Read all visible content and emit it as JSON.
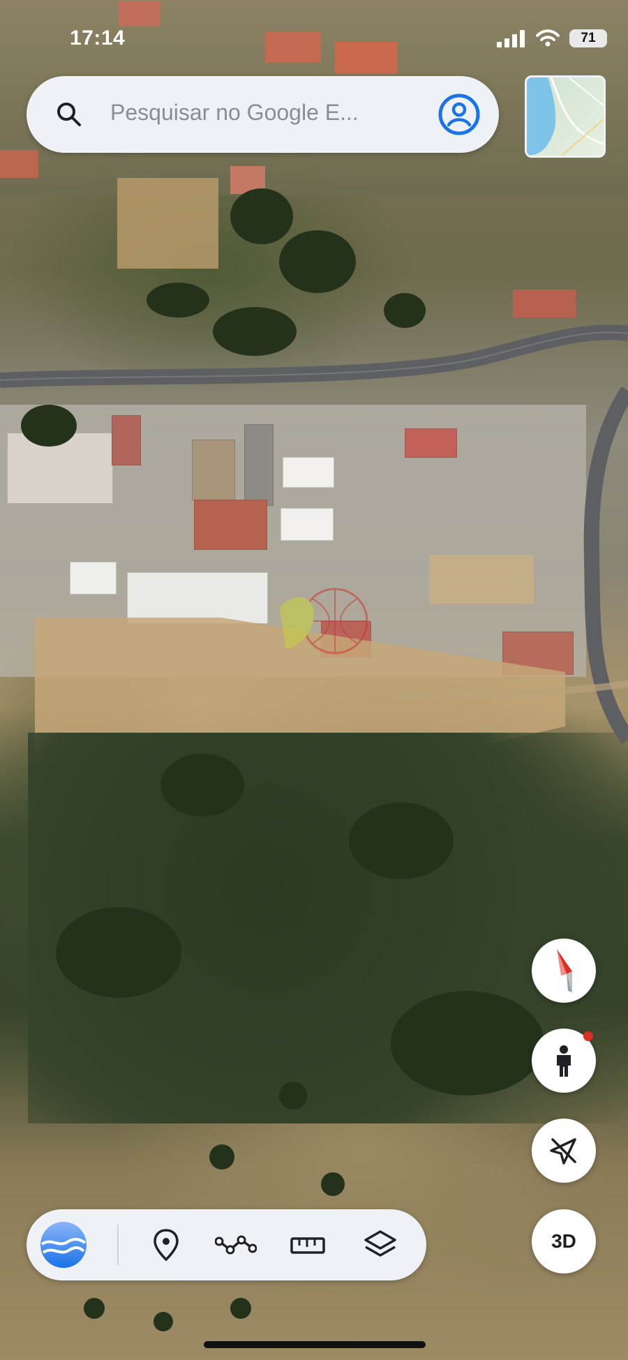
{
  "status_bar": {
    "time": "17:14",
    "battery": "71",
    "icons": [
      "cellular-signal-icon",
      "wifi-icon",
      "battery-icon"
    ]
  },
  "search": {
    "placeholder": "Pesquisar no Google E...",
    "left_icon": "search-icon",
    "right_icon": "account-icon"
  },
  "map": {
    "type": "satellite",
    "thumbnail": "map-layer-thumbnail"
  },
  "controls": {
    "compass": "compass-icon",
    "street_view": "pegman-icon",
    "location": "location-off-icon",
    "three_d_label": "3D"
  },
  "toolbar": {
    "items": [
      {
        "icon": "earth-logo-icon",
        "name": "Google Earth"
      },
      {
        "icon": "place-pin-icon",
        "name": "Add place"
      },
      {
        "icon": "path-icon",
        "name": "Draw path"
      },
      {
        "icon": "ruler-icon",
        "name": "Measure"
      },
      {
        "icon": "layers-icon",
        "name": "Layers"
      }
    ]
  },
  "colors": {
    "accent": "#1a73e8",
    "bar_bg": "#eef1f6",
    "alert_dot": "#d93025"
  }
}
